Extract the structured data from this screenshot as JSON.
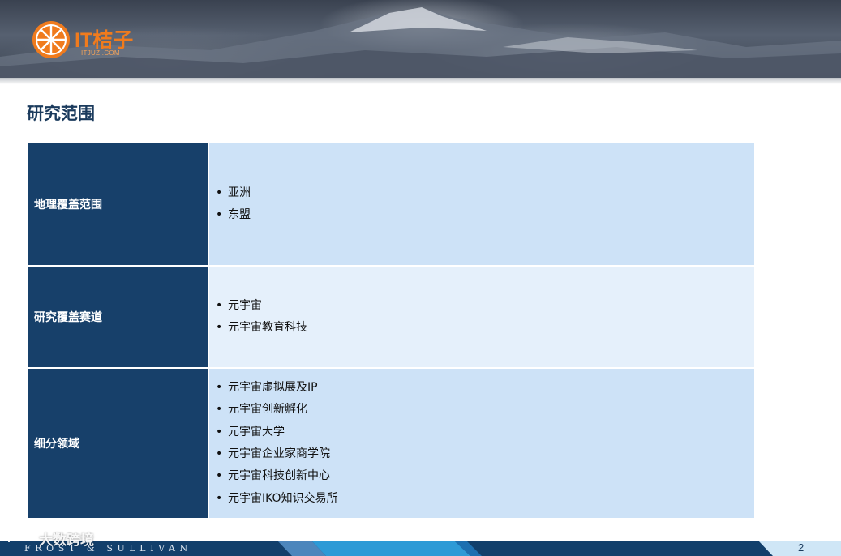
{
  "header": {
    "logo_text": "IT桔子",
    "logo_sub": "ITJUZI.COM"
  },
  "page": {
    "title": "研究范围",
    "number": "2"
  },
  "table": {
    "rows": [
      {
        "label": "地理覆盖范围",
        "items": [
          "亚洲",
          "东盟"
        ]
      },
      {
        "label": "研究覆盖赛道",
        "items": [
          "元宇宙",
          "元宇宙教育科技"
        ]
      },
      {
        "label": "细分领域",
        "items": [
          "元宇宙虚拟展及IP",
          "元宇宙创新孵化",
          "元宇宙大学",
          "元宇宙企业家商学院",
          "元宇宙科技创新中心",
          "元宇宙IKO知识交易所"
        ]
      }
    ],
    "bullet": "•"
  },
  "footer": {
    "brand": "FROST & SULLIVAN"
  },
  "watermark": {
    "text": "大数跨境"
  },
  "colors": {
    "label_bg": "#17406a",
    "content_bg": "#cde2f7",
    "content_bg_alt": "#e5f0fb",
    "title": "#1a3a5c",
    "logo": "#f07b1d",
    "footer": "#123f6b"
  }
}
